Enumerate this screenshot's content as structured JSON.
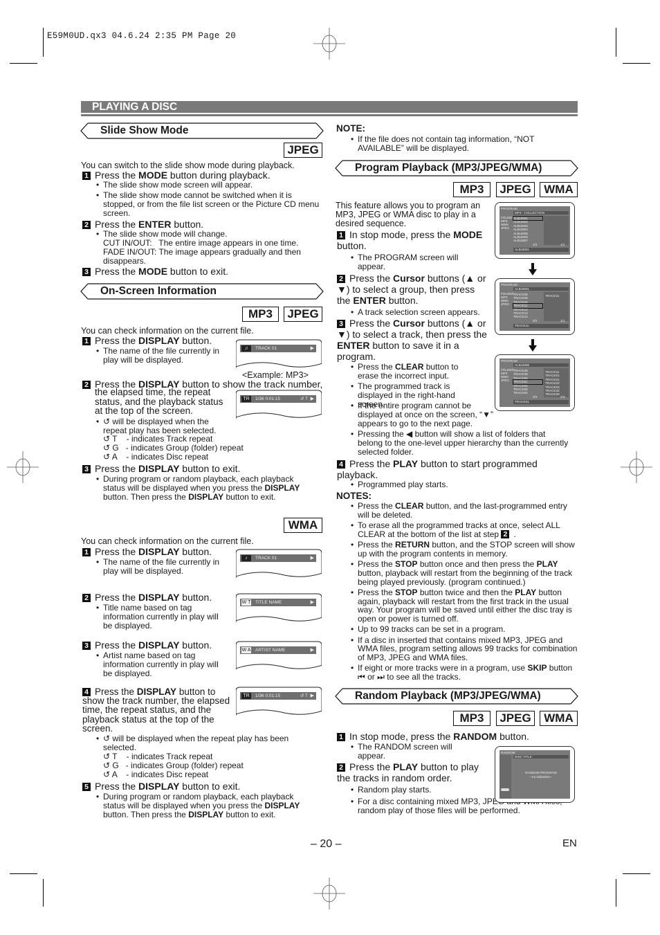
{
  "slug": "E59M0UD.qx3   04.6.24   2:35 PM   Page 20",
  "band_title": "PLAYING A DISC",
  "slide_show": {
    "heading": "Slide Show Mode",
    "badges": [
      "JPEG"
    ],
    "intro": "You can switch to the slide show mode during playback.",
    "steps": [
      {
        "num": "1",
        "pre": "Press the ",
        "bold": "MODE",
        "post": " button during playback."
      },
      {
        "num": "2",
        "pre": "Press the ",
        "bold": "ENTER",
        "post": " button."
      },
      {
        "num": "3",
        "pre": "Press the ",
        "bold": "MODE",
        "post": " button to exit."
      }
    ],
    "bullets_1": [
      "The slide show mode screen will appear.",
      "The slide show mode cannot be switched when it is stopped, or from the file list screen or the Picture CD menu screen."
    ],
    "bullet_2": "The slide show mode will change.",
    "cut": "CUT IN/OUT:   The entire image appears in one time.",
    "fade": "FADE IN/OUT: The image appears gradually and then disappears."
  },
  "onscreen": {
    "heading": "On-Screen Information",
    "badges": [
      "MP3",
      "JPEG"
    ],
    "intro": "You can check information on the current file.",
    "step1": {
      "num": "1",
      "pre": "Press the ",
      "bold": "DISPLAY",
      "post": " button."
    },
    "step1_bullet": "The name of the file currently in play will be displayed.",
    "osd1": {
      "icon": "♫",
      "label": "TRACK 01"
    },
    "example_caption": "<Example: MP3>",
    "step2": {
      "num": "2",
      "pre": "Press the ",
      "bold": "DISPLAY",
      "post": " button to show the track number,",
      "cont": "the elapsed time, the repeat status, and the playback status at the top of the screen."
    },
    "osd2": {
      "icon": "TR",
      "label": "1/36   0:01:15",
      "repeat": "↺ T"
    },
    "repeat_bullet": "↺ will be displayed when the repeat play has been selected.",
    "repeat_items": [
      "↺ T    - indicates Track repeat",
      "↺ G   - indicates Group (folder) repeat",
      "↺ A    - indicates Disc repeat"
    ],
    "step3": {
      "num": "3",
      "pre": "Press the ",
      "bold": "DISPLAY",
      "post": " button to exit."
    },
    "step3_bullet_pre": "During program or random playback, each playback status will be displayed when you press the ",
    "step3_bullet_bold": "DISPLAY",
    "step3_bullet_mid": " button. Then press the ",
    "step3_bullet_bold2": "DISPLAY",
    "step3_bullet_post": " button to exit."
  },
  "wma": {
    "badges": [
      "WMA"
    ],
    "intro": "You can check information on the current file.",
    "steps": [
      {
        "num": "1",
        "pre": "Press the ",
        "bold": "DISPLAY",
        "post": " button.",
        "bullet": "The name of the file currently in play will be displayed.",
        "osd_icon": "♪",
        "osd_label": "TRACK 01"
      },
      {
        "num": "2",
        "pre": "Press the ",
        "bold": "DISPLAY",
        "post": " button.",
        "bullet": "Title name based on tag information currently in play will be displayed.",
        "osd_icon": "W T",
        "osd_label": "TITLE NAME"
      },
      {
        "num": "3",
        "pre": "Press the ",
        "bold": "DISPLAY",
        "post": " button.",
        "bullet": "Artist name based on tag information currently in play will be displayed.",
        "osd_icon": "W A",
        "osd_label": "ARTIST NAME"
      }
    ],
    "step4": {
      "num": "4",
      "pre": "Press the ",
      "bold": "DISPLAY",
      "post": " button to show the track number, the elapsed time, the repeat status, and the playback status at the top of the screen."
    },
    "osd4": {
      "icon": "TR",
      "label": "1/36   0:01:15",
      "repeat": "↺ T"
    },
    "repeat_bullet": "↺ will be displayed when the repeat play has been selected.",
    "repeat_items": [
      "↺ T    - indicates Track repeat",
      "↺ G   - indicates Group (folder) repeat",
      "↺ A    - indicates Disc repeat"
    ],
    "step5": {
      "num": "5",
      "pre": "Press the ",
      "bold": "DISPLAY",
      "post": " button to exit."
    },
    "step5_bullet_pre": "During program or random playback, each playback status will be displayed when you press the ",
    "step5_bullet_bold": "DISPLAY",
    "step5_bullet_mid": " button. Then press the ",
    "step5_bullet_bold2": "DISPLAY",
    "step5_bullet_post": " button to exit."
  },
  "note": {
    "title": "NOTE:",
    "text": "If the file does not contain tag information, “NOT AVAILABLE” will be displayed."
  },
  "program": {
    "heading": "Program Playback (MP3/JPEG/WMA)",
    "badges": [
      "MP3",
      "JPEG",
      "WMA"
    ],
    "intro": "This feature allows you to program an MP3, JPEG or WMA disc to play in a desired sequence.",
    "step1": {
      "num": "1",
      "pre": "In stop mode, press the ",
      "bold": "MODE",
      "post": " button.",
      "bullet": "The PROGRAM screen will appear."
    },
    "step2": {
      "num": "2",
      "pre": "Press the ",
      "bold": "Cursor",
      "post": " buttons (▲ or ▼) to select a group, then press the ",
      "bold2": "ENTER",
      "post2": " button.",
      "bullet": "A track selection screen appears."
    },
    "step3": {
      "num": "3",
      "pre": "Press the ",
      "bold": "Cursor",
      "post": " buttons (▲ or ▼) to select a track, then press the ",
      "bold2": "ENTER",
      "post2": " button to save it in a program."
    },
    "step3_bullets": [
      {
        "pre": "Press the ",
        "bold": "CLEAR",
        "post": " button to erase the incorrect input."
      },
      {
        "pre": "The programmed track is displayed in the right-hand screen.",
        "bold": "",
        "post": ""
      },
      {
        "pre": "If the entire program cannot be displayed at once on the screen, “▼” appears to go to the next page.",
        "bold": "",
        "post": ""
      },
      {
        "pre": "Pressing the ◀ button will show a list of folders that belong to the one-level upper hierarchy than the currently selected folder.",
        "bold": "",
        "post": ""
      }
    ],
    "step4": {
      "num": "4",
      "pre": "Press the ",
      "bold": "PLAY",
      "post": " button to start programmed playback.",
      "bullet": "Programmed play starts."
    },
    "screens": [
      {
        "title": "PROGRAM",
        "header": "MP3 - COLLECTION",
        "side": [
          "FOLDER",
          "MP3",
          "WMA",
          "JPEG"
        ],
        "list": [
          "ALBUM01",
          "ALBUM02",
          "ALBUM03",
          "ALBUM04",
          "ALBUM05",
          "ALBUM06",
          "ALBUM07"
        ],
        "selected": 0,
        "right": [],
        "page": "1/2",
        "page2": "1/1",
        "footer": "ALBUM01"
      },
      {
        "title": "PROGRAM",
        "header": "ALBUM01",
        "side": [
          "FOLDER",
          "MP3",
          "WMA",
          "JPEG"
        ],
        "list": [
          "TRACK08",
          "TRACK09",
          "TRACK10",
          "TRACK11",
          "TRACK12",
          "TRACK13",
          "TRACK14"
        ],
        "selected": 3,
        "right": [
          "TRACK11"
        ],
        "page": "2/2",
        "page2": "1/1",
        "footer": "TRACK11"
      },
      {
        "title": "PROGRAM",
        "header": "ALBUM08",
        "side": [
          "FOLDER",
          "MP3",
          "WMA",
          "JPEG"
        ],
        "list": [
          "TRACK48",
          "TRACK49",
          "TRACK50",
          "TRACK51",
          "TRACK52",
          "TRACK53",
          "TRACK54"
        ],
        "selected": 3,
        "right": [
          "TRACK11",
          "TRACK01",
          "TRACK21",
          "TRACK22",
          "TRACK03",
          "TRACK32",
          "TRACK26"
        ],
        "page": "2/3",
        "page2": "2/3",
        "footer": "TRACK51"
      }
    ]
  },
  "notes": {
    "title": "NOTES:",
    "items": [
      {
        "html": "Press the <b>CLEAR</b> button, and the last-programmed entry will be deleted."
      },
      {
        "html": "To erase all the programmed tracks at once, select ALL CLEAR at the bottom of the list at step <span class=\"inlinenum\">2</span>."
      },
      {
        "html": "Press the <b>RETURN</b> button, and the STOP screen will show up with the program contents in memory."
      },
      {
        "html": "Press the <b>STOP</b> button once and then press the <b>PLAY</b> button, playback will restart from the beginning of the track being played previously. (program continued.)"
      },
      {
        "html": "Press the <b>STOP</b> button twice and then the <b>PLAY</b> button again, playback will restart from the first track in the usual way. Your program will be saved until either the disc tray is open or power is turned off."
      },
      {
        "html": "Up to 99 tracks can be set in a program."
      },
      {
        "html": "If a disc in inserted that contains mixed MP3, JPEG and WMA files, program setting allows 99 tracks for combination of MP3, JPEG and WMA files."
      },
      {
        "html": "If eight or more tracks were in a program, use <b>SKIP</b> button ⏮ or ⏭ to see all the tracks."
      }
    ]
  },
  "random": {
    "heading": "Random Playback (MP3/JPEG/WMA)",
    "badges": [
      "MP3",
      "JPEG",
      "WMA"
    ],
    "step1": {
      "num": "1",
      "pre": "In stop mode, press the ",
      "bold": "RANDOM",
      "post": " button.",
      "bullet": "The RANDOM screen will appear."
    },
    "step2": {
      "num": "2",
      "pre": "Press the ",
      "bold": "PLAY",
      "post": " button to play the tracks in random order."
    },
    "bullets": [
      "Random play starts.",
      "For a disc containing mixed MP3, JPEG and WMA files, random play of those files will be performed."
    ],
    "screen": {
      "title": "RANDOM",
      "header": "DISC TITLE",
      "center": "RANDOM PROGRAM",
      "center2": "--no indication--"
    }
  },
  "page_number": "– 20 –",
  "lang": "EN"
}
